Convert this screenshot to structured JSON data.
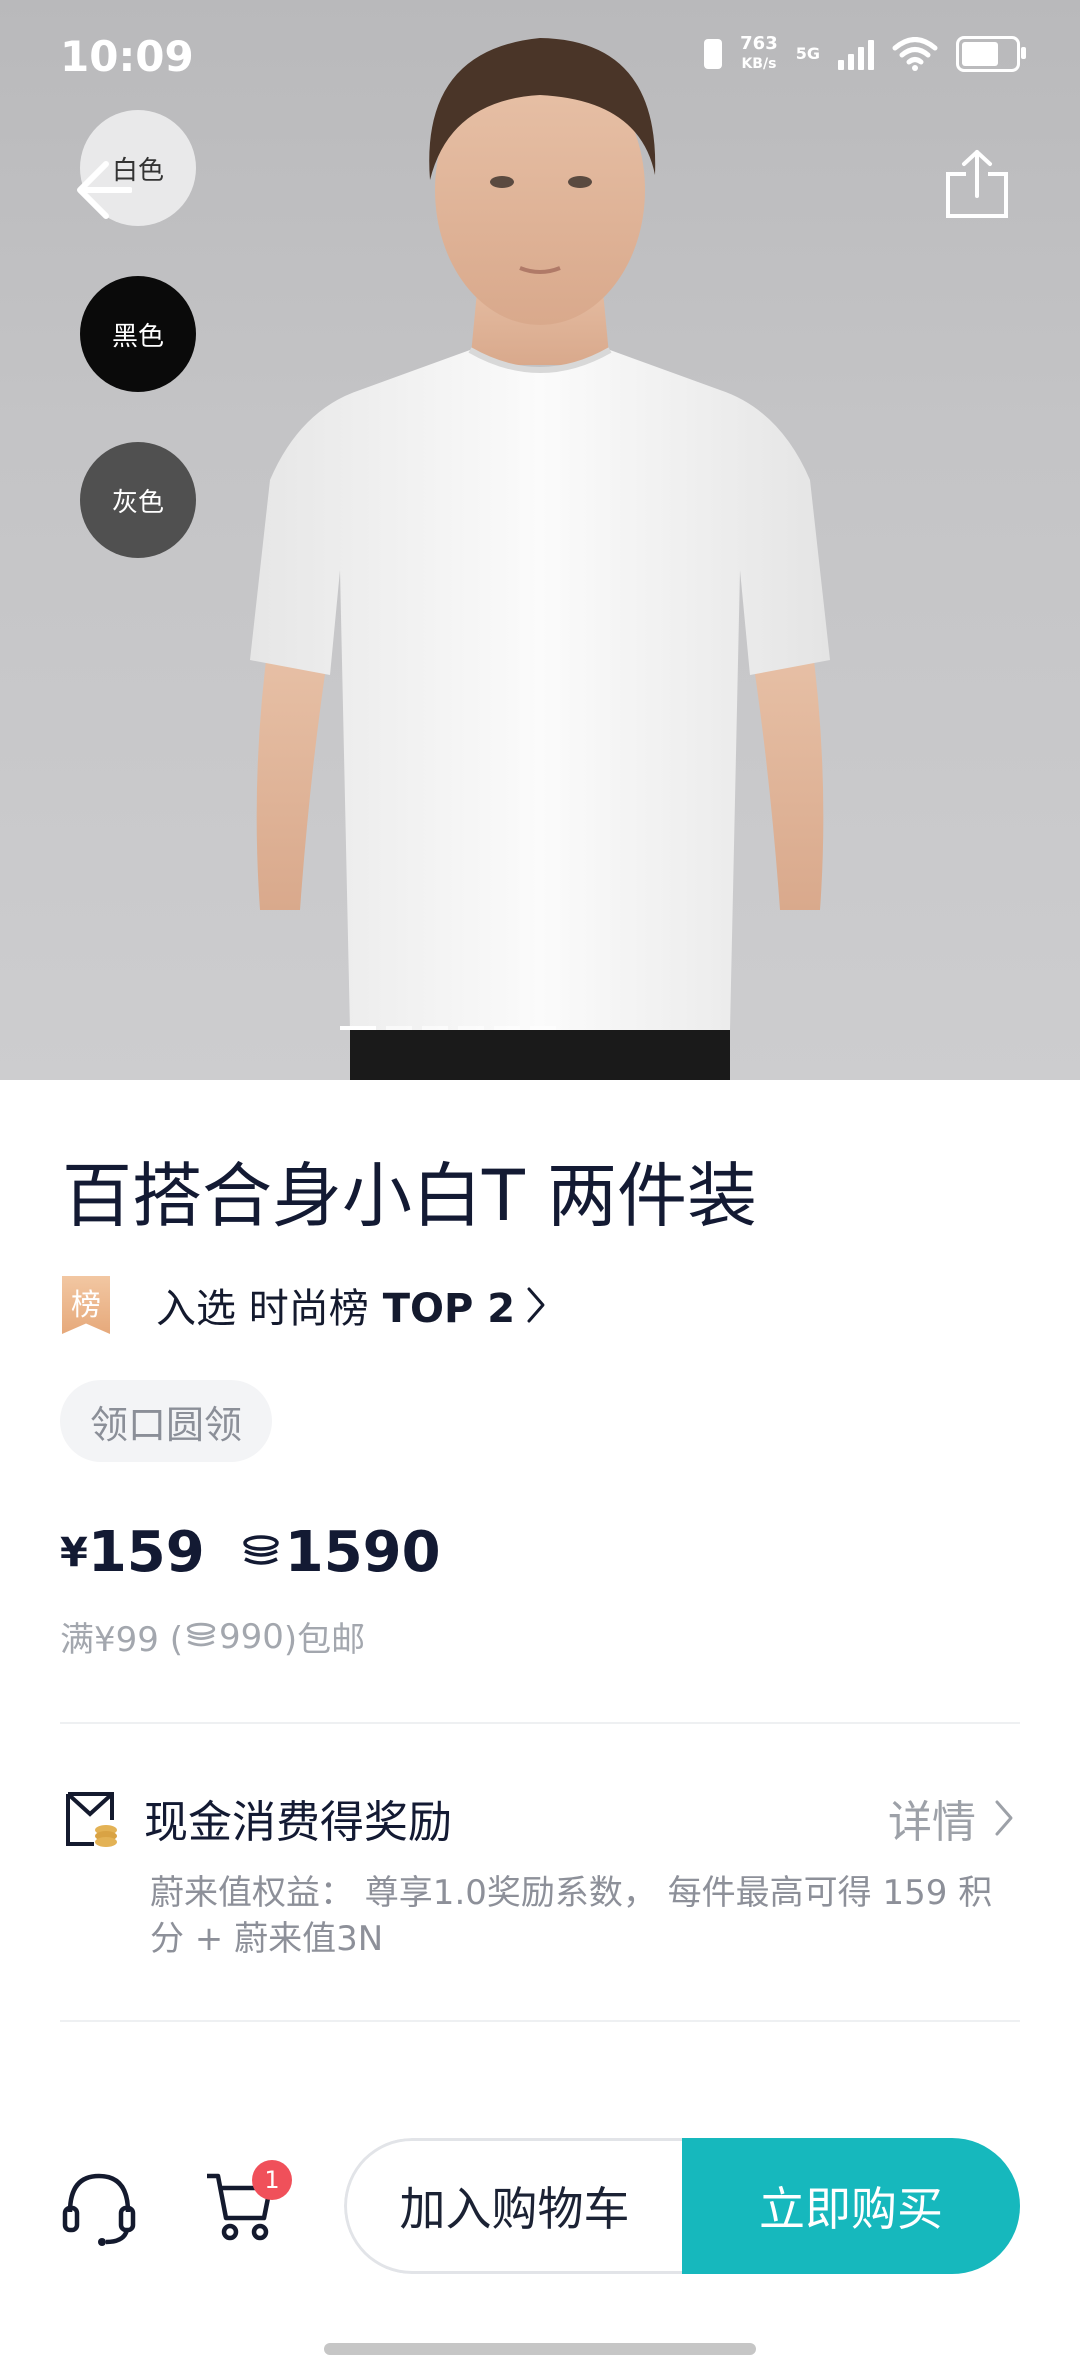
{
  "status_bar": {
    "time": "10:09",
    "net_speed_value": "763",
    "net_speed_unit": "KB/s",
    "network_type": "5G"
  },
  "hero": {
    "colors": [
      {
        "label": "白色",
        "color": "#e9e9ea"
      },
      {
        "label": "黑色",
        "color": "#0a0a0a"
      },
      {
        "label": "灰色",
        "color": "#505050"
      }
    ],
    "icons": {
      "back": "back-arrow-icon",
      "share": "share-icon"
    }
  },
  "product": {
    "title": "百搭合身小白T 两件装",
    "rank_badge": "榜",
    "rank_text": "入选 时尚榜",
    "rank_top": "TOP 2",
    "tag": "领口圆领",
    "price_currency": "¥",
    "price": "159",
    "points_price": "1590",
    "shipping_prefix": "满¥99 (",
    "shipping_points": "990",
    "shipping_suffix": ")包邮"
  },
  "reward": {
    "title": "现金消费得奖励",
    "detail_label": "详情",
    "description": "蔚来值权益： 尊享1.0奖励系数， 每件最高可得 159 积分 + 蔚来值3N"
  },
  "bottom_bar": {
    "cart_count": "1",
    "add_to_cart": "加入购物车",
    "buy_now": "立即购买",
    "accent_color": "#16b8bd"
  }
}
